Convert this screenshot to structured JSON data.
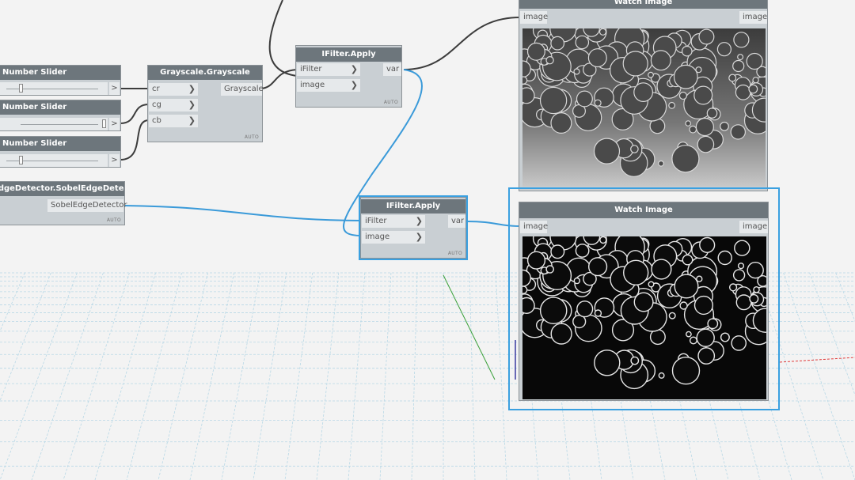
{
  "nodes": {
    "slider1": {
      "title": "Number Slider",
      "arrow": ">",
      "value_fraction": 0.05
    },
    "slider2": {
      "title": "Number Slider",
      "arrow": ">",
      "value_fraction": 0.95
    },
    "slider3": {
      "title": "Number Slider",
      "arrow": ">",
      "value_fraction": 0.05
    },
    "sobel": {
      "title": "EdgeDetector.SobelEdgeDetector",
      "output": "SobelEdgeDetector",
      "auto": "AUTO"
    },
    "grayscale": {
      "title": "Grayscale.Grayscale",
      "inputs": [
        "cr",
        "cg",
        "cb"
      ],
      "output": "Grayscale",
      "auto": "AUTO"
    },
    "ifilter1": {
      "title": "IFilter.Apply",
      "inputs": [
        "iFilter",
        "image"
      ],
      "output": "var",
      "auto": "AUTO"
    },
    "ifilter2": {
      "title": "IFilter.Apply",
      "inputs": [
        "iFilter",
        "image"
      ],
      "output": "var",
      "auto": "AUTO"
    },
    "watch1": {
      "title": "Watch Image",
      "input": "image",
      "output": "image"
    },
    "watch2": {
      "title": "Watch Image",
      "input": "image",
      "output": "image"
    }
  },
  "colors": {
    "background": "#f3f3f3",
    "node_body": "#c9cfd3",
    "node_header": "#6d767c",
    "port_bg": "#e6e9eb",
    "wire_dark": "#3c3c3c",
    "wire_selected": "#3a9ad9",
    "selection": "#3aa0e0",
    "grid": "#b8d8e6"
  },
  "icons": {
    "port_chevron": "chevron-right-icon"
  }
}
